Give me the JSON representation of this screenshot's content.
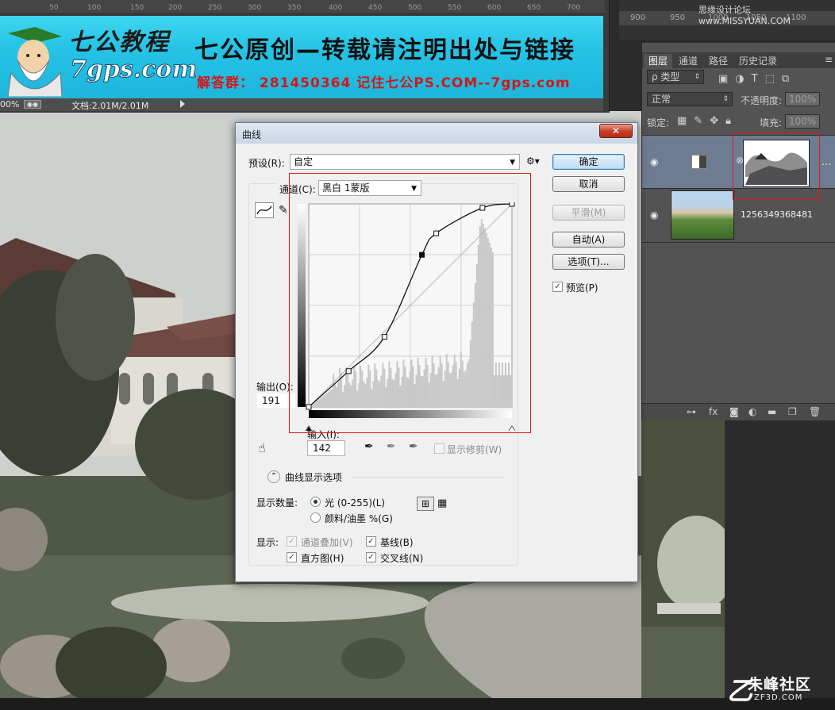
{
  "doc_window": {
    "ruler_ticks": [
      "50",
      "100",
      "150",
      "200",
      "250",
      "300",
      "350",
      "400",
      "450",
      "500",
      "550",
      "600",
      "650",
      "700"
    ],
    "banner": {
      "logo_cn": "七公教程",
      "logo_url": "7gps.com",
      "headline": "七公原创—转载请注明出处与链接",
      "subline": "解答群： 281450364    记住七公PS.COM--7gps.com"
    },
    "status": {
      "zoom": "00%",
      "info": "文档:2.01M/2.01M"
    }
  },
  "top_right": {
    "ruler_ticks": [
      "900",
      "950",
      "1000",
      "1050",
      "1100"
    ],
    "watermark": "思缘设计论坛 www.MISSYUAN.COM"
  },
  "layers_panel": {
    "tabs": [
      "图层",
      "通道",
      "路径",
      "历史记录"
    ],
    "menu_icon": "menu-icon",
    "filter_kind": "ρ 类型",
    "blend_mode": "正常",
    "opacity_label": "不透明度:",
    "opacity_value": "100%",
    "lock_label": "锁定:",
    "fill_label": "填充:",
    "fill_value": "100%",
    "layers": [
      {
        "name": "",
        "kind": "curves-adjustment",
        "selected": true
      },
      {
        "name": "1256349368481",
        "kind": "photo",
        "selected": false
      }
    ]
  },
  "curves_dialog": {
    "title": "曲线",
    "close": "✕",
    "preset_label": "预设(R):",
    "preset_value": "自定",
    "channel_label": "通道(C):",
    "channel_value": "黑白 1蒙版",
    "output_label": "输出(O):",
    "output_value": "191",
    "input_label": "输入(I):",
    "input_value": "142",
    "show_clipping": "显示修剪(W)",
    "display_options": "曲线显示选项",
    "show_amount_label": "显示数量:",
    "light_option": "光 (0-255)(L)",
    "pigment_option": "颜料/油墨 %(G)",
    "show_label": "显示:",
    "channel_overlays": "通道叠加(V)",
    "baseline": "基线(B)",
    "histogram": "直方图(H)",
    "intersection": "交叉线(N)",
    "buttons": {
      "ok": "确定",
      "cancel": "取消",
      "smooth": "平滑(M)",
      "auto": "自动(A)",
      "options": "选项(T)...",
      "preview": "预览(P)"
    },
    "curve_points": [
      [
        0,
        0
      ],
      [
        50,
        45
      ],
      [
        95,
        88
      ],
      [
        142,
        191
      ],
      [
        160,
        218
      ],
      [
        218,
        250
      ],
      [
        255,
        255
      ]
    ],
    "selected_point": [
      142,
      191
    ],
    "histogram_desc": "histogram-mostly-right"
  },
  "footer_watermark": {
    "brand": "朱峰社区",
    "url": "ZF3D.COM"
  }
}
